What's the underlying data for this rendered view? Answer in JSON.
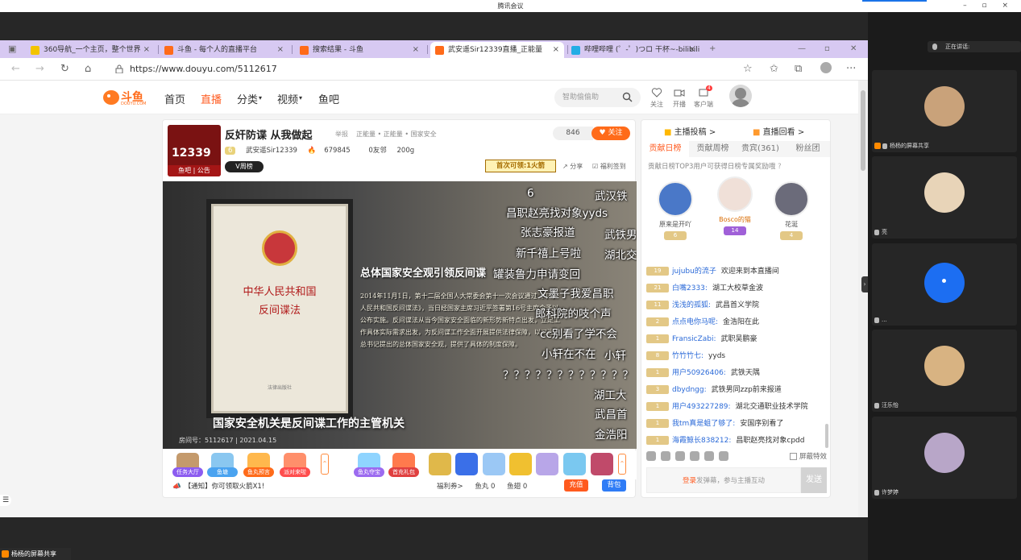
{
  "meeting": {
    "title": "腾讯会议",
    "window_controls": "– ▫ ×",
    "speaking_label": "正在讲话:",
    "share_label": "杨杨的屏幕共享",
    "participants": [
      {
        "name": "杨杨的屏幕共享",
        "avatar_color": "#c9a27a"
      },
      {
        "name": "亮",
        "avatar_color": "#e8d4b8"
      },
      {
        "name": "...",
        "avatar_color": "#1c6ef2"
      },
      {
        "name": "汪乐怡",
        "avatar_color": "#d8b382"
      },
      {
        "name": "许梦婷",
        "avatar_color": "#b8a6c8"
      }
    ]
  },
  "browser": {
    "tabs": [
      {
        "title": "360导航_一个主页，整个世界",
        "fav_color": "#f3c400"
      },
      {
        "title": "斗鱼 - 每个人的直播平台",
        "fav_color": "#ff6b1a"
      },
      {
        "title": "搜索结果 - 斗鱼",
        "fav_color": "#ff6b1a"
      },
      {
        "title": "武安遥Sir12339直播_正能量",
        "fav_color": "#ff6b1a"
      },
      {
        "title": "哔哩哔哩 (゜-゜)つロ 干杯~-bilibili",
        "fav_color": "#23ade5"
      }
    ],
    "new_tab": "+",
    "url": "https://www.douyu.com/5112617",
    "nav": {
      "back": "←",
      "forward": "→",
      "reload": "↻",
      "home": "⌂",
      "more": "···"
    }
  },
  "douyu": {
    "logo_text": "斗鱼",
    "logo_sub": "DOUYU.COM",
    "nav": [
      "首页",
      "直播",
      "分类",
      "视频",
      "鱼吧"
    ],
    "nav_active": "直播",
    "search_placeholder": "智助偷偷助",
    "header_actions": [
      "关注",
      "开播",
      "客户端"
    ],
    "header_badge": "4",
    "room": {
      "avatar_big": "12339",
      "avatar_small": "鱼吧 | 公告",
      "title": "反奸防谍 从我做起",
      "report": "举报",
      "category": "正能量 • 正能量 • 国家安全",
      "follow_count": "846",
      "follow_label": "关注",
      "level": "6",
      "anchor": "武安遥Sir12339",
      "hot": "679845",
      "friends": "0友邻",
      "weight": "200g",
      "vbadge": "V周榜",
      "promo": "首次可领:1火箭",
      "share": "分享",
      "sign": "福利签到"
    },
    "video": {
      "book_title_1": "中华人民共和国",
      "book_title_2": "反间谍法",
      "book_publisher": "法律出版社",
      "headline": "总体国家安全观引领反间谍",
      "paragraph": "2014年11月1日，第十二届全国人大常委会第十一次会议通过《中华人民共和国反间谍法》，当日经国家主席习近平签署第16号主席令予以公布实施。反间谍法从当今国家安全面临的新形势新特点出发，立足工作具体实际需求出发，为反间谍工作全面开展提供法律保障，以习近平总书记提出的总体国家安全观，提供了具体的制度保障。",
      "caption": "国家安全机关是反间谍工作的主管机关",
      "room_info": "房间号：5112617 | 2021.04.15",
      "danmu": [
        "6",
        "武汉铁",
        "昌职赵亮找对象yyds",
        "张志豪报道",
        "武铁男",
        "新千禧上号啦",
        "湖北交",
        "罐装鲁力申请变回",
        "文墨子我爱昌职",
        "郎科院的吱个声",
        "cc别看了学不会",
        "小轩在不在",
        "小轩",
        "？？？？？？？？？？？？",
        "湖工大",
        "武昌首",
        "金浩阳"
      ]
    },
    "gifts": [
      {
        "label": "任务大厅",
        "color": "#c49a6c",
        "label_color": "#8c5cf0"
      },
      {
        "label": "鱼塘",
        "color": "#8ac7f0",
        "label_color": "#4aa3f0"
      },
      {
        "label": "鱼丸预言",
        "color": "#ffb84d",
        "label_color": "#ff6b1a"
      },
      {
        "label": "派对来啦",
        "color": "#ff8f6b",
        "label_color": "#ff4d4d"
      },
      {
        "label": "鱼丸夺宝",
        "color": "#8fd4ff",
        "label_color": "#9c6bf0"
      },
      {
        "label": "首充礼包",
        "color": "#ff7a4d",
        "label_color": "#e04040"
      },
      {
        "label": "",
        "color": "#e0b84a",
        "label_color": "#ffffff"
      },
      {
        "label": "",
        "color": "#3a6fe8",
        "label_color": "#ffffff"
      },
      {
        "label": "",
        "color": "#9bc8f5",
        "label_color": "#ffffff"
      },
      {
        "label": "",
        "color": "#f0c030",
        "label_color": "#ffffff"
      },
      {
        "label": "",
        "color": "#b8a6e8",
        "label_color": "#ffffff"
      },
      {
        "label": "",
        "color": "#7ac8f0",
        "label_color": "#ffffff"
      },
      {
        "label": "",
        "color": "#c04a6a",
        "label_color": "#ffffff"
      }
    ],
    "notice": "【通知】你可领取火箭X1!",
    "bottom": {
      "sign": "福利券>",
      "fishball": "鱼丸 0",
      "fishfin": "鱼翅 0",
      "recharge": "充值",
      "bag": "背包"
    },
    "right": {
      "top_a": "主播投稿 >",
      "top_b": "直播回看 >",
      "tabs": [
        "贡献日榜",
        "贡献周榜",
        "贵宾(361)",
        "粉丝团"
      ],
      "note": "贡献日榜TOP3用户可获得日榜专属奖励哦",
      "top3": [
        {
          "rank": "2",
          "name": "原来是开吖",
          "lvl": "6",
          "color": "#4a78c8",
          "lvl_color": "#e3c886"
        },
        {
          "rank": "1",
          "name": "Bosco的猫",
          "lvl": "14",
          "color": "#f0e0d8",
          "lvl_color": "#a060d8"
        },
        {
          "rank": "3",
          "name": "花涎",
          "lvl": "4",
          "color": "#6b6b7a",
          "lvl_color": "#e3c886"
        }
      ],
      "chat": [
        {
          "lvl": "19",
          "user": "jujubu的流子",
          "msg": "欢迎来到本直播间"
        },
        {
          "lvl": "21",
          "user": "白嘴2333:",
          "msg": "湖工大校草金波"
        },
        {
          "lvl": "11",
          "user": "浅浅的孤狐:",
          "msg": "武昌首义学院"
        },
        {
          "lvl": "2",
          "user": "点点电你马呢:",
          "msg": "金浩阳在此"
        },
        {
          "lvl": "1",
          "user": "FransicZabi:",
          "msg": "武职吴鹏豪"
        },
        {
          "lvl": "8",
          "user": "竹竹竹七:",
          "msg": "yyds"
        },
        {
          "lvl": "1",
          "user": "用户50926406:",
          "msg": "武铁天隅"
        },
        {
          "lvl": "3",
          "user": "dbydngg:",
          "msg": "武铁男同zzp前来报道"
        },
        {
          "lvl": "1",
          "user": "用户493227289:",
          "msg": "湖北交通职业技术学院"
        },
        {
          "lvl": "1",
          "user": "我tm真是蛆了够了:",
          "msg": "安国序别看了"
        },
        {
          "lvl": "1",
          "user": "海霞鲸长838212:",
          "msg": "昌职赵亮找对象cpdd"
        }
      ],
      "fx_label": "屏蔽特效",
      "input_login": "登录",
      "input_rest": "发弹幕，参与主播互动",
      "send": "发送"
    },
    "menu_btn": "☰"
  }
}
